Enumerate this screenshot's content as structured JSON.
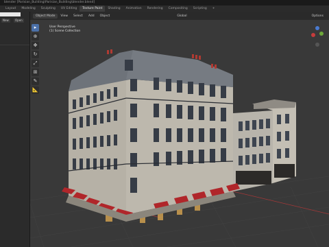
{
  "window": {
    "title": "blender [Parisian_Building\\Parisian_Building\\blender.blend]"
  },
  "tabs": [
    "Layout",
    "Modeling",
    "Sculpting",
    "UV Editing",
    "Texture Paint",
    "Shading",
    "Animation",
    "Rendering",
    "Compositing",
    "Scripting",
    "+"
  ],
  "active_tab": "Texture Paint",
  "left_panel": {
    "button_open": "Open",
    "button_new": "New"
  },
  "viewport_header": {
    "mode": "Object Mode",
    "menus": [
      "View",
      "Select",
      "Add",
      "Object"
    ],
    "orientation": "Global",
    "options": "Options"
  },
  "viewport_overlay": {
    "perspective": "User Perspective",
    "collection": "(1) Scene Collection"
  },
  "colors": {
    "accent": "#4b70a8",
    "background": "#393939",
    "grid_x": "#a53838",
    "grid_y": "#7a9a3a"
  },
  "icons": [
    "select-box-icon",
    "cursor-icon",
    "move-icon",
    "rotate-icon",
    "scale-icon",
    "transform-icon",
    "annotate-icon",
    "measure-icon"
  ]
}
